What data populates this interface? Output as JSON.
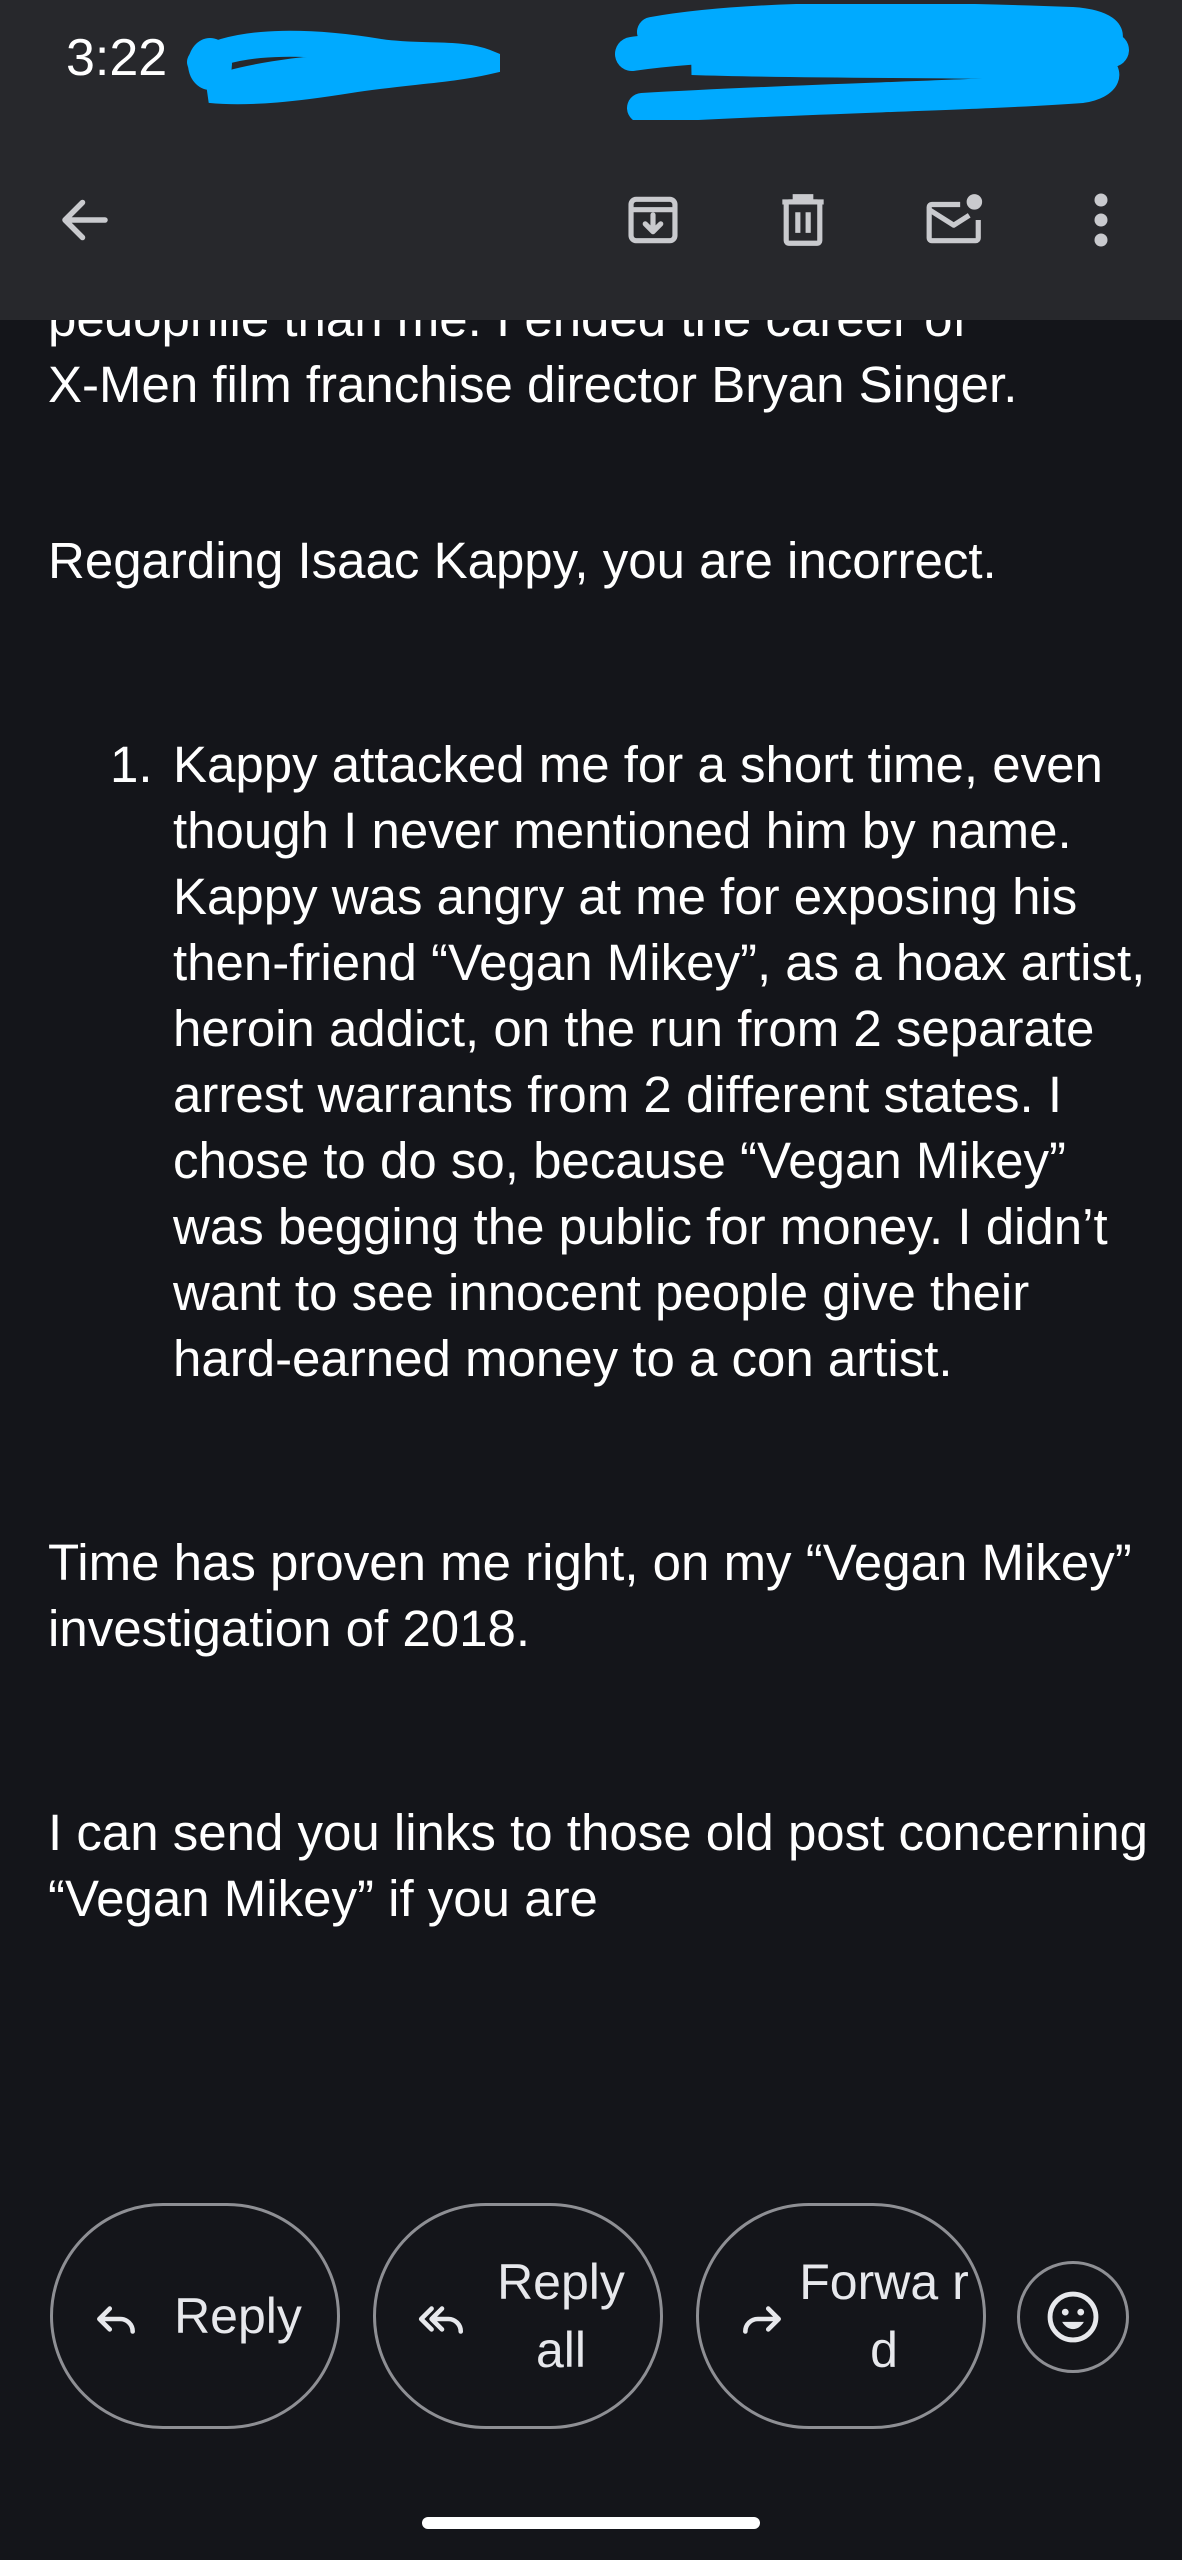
{
  "status_bar": {
    "time": "3:22"
  },
  "app_bar": {
    "back_icon": "arrow-back-icon",
    "archive_icon": "archive-icon",
    "delete_icon": "trash-icon",
    "mark_unread_icon": "mail-unread-icon",
    "overflow_icon": "more-vert-icon"
  },
  "email": {
    "partial_top_line": "pedophile than me.  I ended the career of",
    "para1": "X-Men film franchise director Bryan Singer.",
    "para2": "Regarding Isaac Kappy, you are incorrect.",
    "list_item_number": "1.",
    "list_item_text": "Kappy attacked me for a short time, even though I never mentioned him by name.   Kappy was angry at me for exposing his then-friend “Vegan Mikey”, as a hoax artist, heroin addict, on the run from 2 separate arrest warrants from 2 different states.  I chose to do so, because “Vegan Mikey” was begging the public for money.  I didn’t want to see innocent people give their hard-earned money to a con artist.",
    "para3": "Time has proven me right, on my “Vegan Mikey” investigation of 2018.",
    "para4": "I can send you links to those old post concerning “Vegan Mikey” if you are"
  },
  "actions": {
    "reply_label": "Reply",
    "reply_all_label": "Reply all",
    "forward_label": "Forwa rd",
    "reply_icon": "reply-icon",
    "reply_all_icon": "reply-all-icon",
    "forward_icon": "forward-icon",
    "emoji_icon": "emoji-icon"
  },
  "colors": {
    "background": "#14151a",
    "bar_background": "#27282c",
    "text": "#ffffff",
    "pill_border": "#8e8f94",
    "redaction": "#00aaff"
  }
}
